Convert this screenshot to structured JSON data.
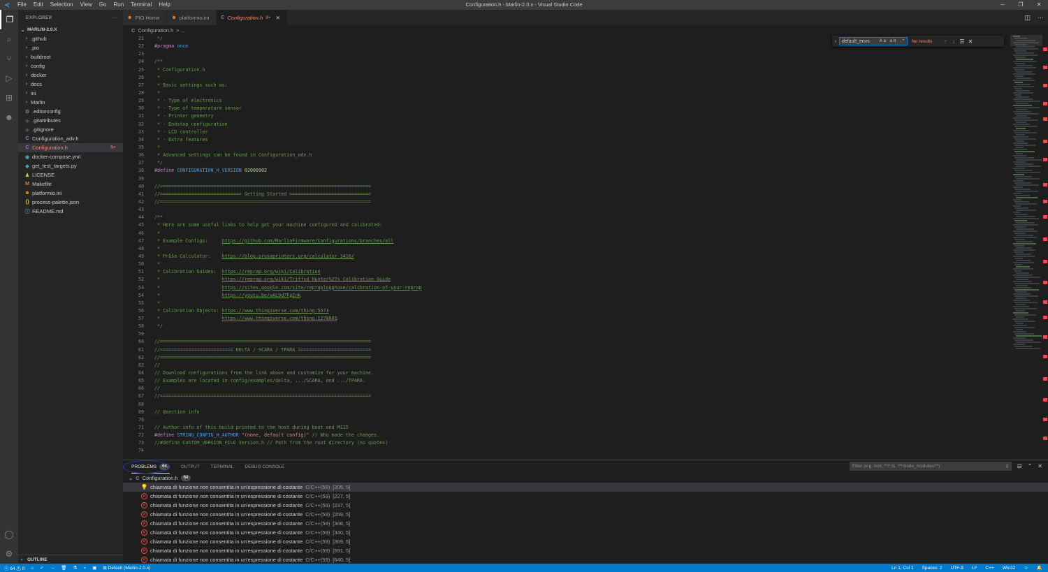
{
  "window": {
    "title": "Configuration.h - Marlin-2.0.x - Visual Studio Code",
    "menu": [
      "File",
      "Edit",
      "Selection",
      "View",
      "Go",
      "Run",
      "Terminal",
      "Help"
    ]
  },
  "sidebar": {
    "header": "EXPLORER",
    "more": "···",
    "root": "MARLIN-2.0.X",
    "items": [
      {
        "label": ".github",
        "type": "folder"
      },
      {
        "label": ".pio",
        "type": "folder"
      },
      {
        "label": "buildroot",
        "type": "folder"
      },
      {
        "label": "config",
        "type": "folder"
      },
      {
        "label": "docker",
        "type": "folder"
      },
      {
        "label": "docs",
        "type": "folder"
      },
      {
        "label": "ini",
        "type": "folder"
      },
      {
        "label": "Marlin",
        "type": "folder"
      },
      {
        "label": ".editorconfig",
        "type": "gear",
        "icon": "⚙",
        "color": "#6d8086"
      },
      {
        "label": ".gitattributes",
        "type": "git",
        "icon": "◆",
        "color": "#41535b"
      },
      {
        "label": ".gitignore",
        "type": "git",
        "icon": "◆",
        "color": "#41535b"
      },
      {
        "label": "Configuration_adv.h",
        "type": "c",
        "icon": "C",
        "color": "#a074c4"
      },
      {
        "label": "Configuration.h",
        "type": "c",
        "icon": "C",
        "color": "#a074c4",
        "selected": true,
        "error": true,
        "badge": "9+"
      },
      {
        "label": "docker-compose.yml",
        "type": "docker",
        "icon": "◉",
        "color": "#519aba"
      },
      {
        "label": "get_test_targets.py",
        "type": "python",
        "icon": "◆",
        "color": "#519aba"
      },
      {
        "label": "LICENSE",
        "type": "license",
        "icon": "♟",
        "color": "#cbcb41"
      },
      {
        "label": "Makefile",
        "type": "make",
        "icon": "M",
        "color": "#e37933"
      },
      {
        "label": "platformio.ini",
        "type": "pio",
        "icon": "☻",
        "color": "#f5871f"
      },
      {
        "label": "process-palette.json",
        "type": "json",
        "icon": "{}",
        "color": "#cbcb41"
      },
      {
        "label": "README.md",
        "type": "md",
        "icon": "ⓘ",
        "color": "#519aba"
      }
    ],
    "outline": "OUTLINE"
  },
  "tabs": [
    {
      "label": "PIO Home",
      "icon": "☻",
      "color": "#f5871f",
      "active": false
    },
    {
      "label": "platformio.ini",
      "icon": "☻",
      "color": "#f5871f",
      "active": false
    },
    {
      "label": "Configuration.h",
      "icon": "C",
      "color": "#a074c4",
      "active": true,
      "badge": "9+"
    }
  ],
  "breadcrumb": {
    "file": "Configuration.h",
    "rest": "> ..."
  },
  "find": {
    "value": "default_envs",
    "options": "Aa ab .*",
    "result": "No results"
  },
  "editor": {
    "lines": [
      {
        "n": "21",
        "t": [
          [
            "comment",
            " */"
          ]
        ]
      },
      {
        "n": "22",
        "t": [
          [
            "pre",
            "#pragma"
          ],
          [
            "plain",
            " "
          ],
          [
            "macro",
            "once"
          ]
        ]
      },
      {
        "n": "23",
        "t": []
      },
      {
        "n": "24",
        "t": [
          [
            "comment",
            "/**"
          ]
        ]
      },
      {
        "n": "25",
        "t": [
          [
            "comment",
            " * Configuration.h"
          ]
        ]
      },
      {
        "n": "26",
        "t": [
          [
            "comment",
            " *"
          ]
        ]
      },
      {
        "n": "27",
        "t": [
          [
            "comment",
            " * Basic settings such as:"
          ]
        ]
      },
      {
        "n": "28",
        "t": [
          [
            "comment",
            " *"
          ]
        ]
      },
      {
        "n": "29",
        "t": [
          [
            "comment",
            " * - Type of electronics"
          ]
        ]
      },
      {
        "n": "30",
        "t": [
          [
            "comment",
            " * - Type of temperature sensor"
          ]
        ]
      },
      {
        "n": "31",
        "t": [
          [
            "comment",
            " * - Printer geometry"
          ]
        ]
      },
      {
        "n": "32",
        "t": [
          [
            "comment",
            " * - Endstop configuration"
          ]
        ]
      },
      {
        "n": "33",
        "t": [
          [
            "comment",
            " * - LCD controller"
          ]
        ]
      },
      {
        "n": "34",
        "t": [
          [
            "comment",
            " * - Extra features"
          ]
        ]
      },
      {
        "n": "35",
        "t": [
          [
            "comment",
            " *"
          ]
        ]
      },
      {
        "n": "36",
        "t": [
          [
            "comment",
            " * Advanced settings can be found in Configuration_adv.h"
          ]
        ]
      },
      {
        "n": "37",
        "t": [
          [
            "comment",
            " */"
          ]
        ]
      },
      {
        "n": "38",
        "t": [
          [
            "pre",
            "#define"
          ],
          [
            "plain",
            " "
          ],
          [
            "macro",
            "CONFIGURATION_H_VERSION"
          ],
          [
            "plain",
            " "
          ],
          [
            "num",
            "02000902"
          ]
        ]
      },
      {
        "n": "39",
        "t": []
      },
      {
        "n": "40",
        "t": [
          [
            "comment",
            "//==========================================================================="
          ]
        ]
      },
      {
        "n": "41",
        "t": [
          [
            "comment",
            "//============================= Getting Started ============================="
          ]
        ]
      },
      {
        "n": "42",
        "t": [
          [
            "comment",
            "//==========================================================================="
          ]
        ]
      },
      {
        "n": "43",
        "t": []
      },
      {
        "n": "44",
        "t": [
          [
            "comment",
            "/**"
          ]
        ]
      },
      {
        "n": "45",
        "t": [
          [
            "comment",
            " * Here are some useful links to help get your machine configured and calibrated:"
          ]
        ]
      },
      {
        "n": "46",
        "t": [
          [
            "comment",
            " *"
          ]
        ]
      },
      {
        "n": "47",
        "t": [
          [
            "comment",
            " * Example Configs:     "
          ],
          [
            "link",
            "https://github.com/MarlinFirmware/Configurations/branches/all"
          ]
        ]
      },
      {
        "n": "48",
        "t": [
          [
            "comment",
            " *"
          ]
        ]
      },
      {
        "n": "49",
        "t": [
          [
            "comment",
            " * Průša Calculator:    "
          ],
          [
            "link",
            "https://blog.prusaprinters.org/calculator_3416/"
          ]
        ]
      },
      {
        "n": "50",
        "t": [
          [
            "comment",
            " *"
          ]
        ]
      },
      {
        "n": "51",
        "t": [
          [
            "comment",
            " * Calibration Guides:  "
          ],
          [
            "link",
            "https://reprap.org/wiki/Calibration"
          ]
        ]
      },
      {
        "n": "52",
        "t": [
          [
            "comment",
            " *                      "
          ],
          [
            "link",
            "https://reprap.org/wiki/Triffid_Hunter%27s_Calibration_Guide"
          ]
        ]
      },
      {
        "n": "53",
        "t": [
          [
            "comment",
            " *                      "
          ],
          [
            "link",
            "https://sites.google.com/site/repraplogphase/calibration-of-your-reprap"
          ]
        ]
      },
      {
        "n": "54",
        "t": [
          [
            "comment",
            " *                      "
          ],
          [
            "link",
            "https://youtu.be/wAL9d7FgInk"
          ]
        ]
      },
      {
        "n": "55",
        "t": [
          [
            "comment",
            " *"
          ]
        ]
      },
      {
        "n": "56",
        "t": [
          [
            "comment",
            " * Calibration Objects: "
          ],
          [
            "link",
            "https://www.thingiverse.com/thing:5573"
          ]
        ]
      },
      {
        "n": "57",
        "t": [
          [
            "comment",
            " *                      "
          ],
          [
            "link",
            "https://www.thingiverse.com/thing:1278865"
          ]
        ]
      },
      {
        "n": "58",
        "t": [
          [
            "comment",
            " */"
          ]
        ]
      },
      {
        "n": "59",
        "t": []
      },
      {
        "n": "60",
        "t": [
          [
            "comment",
            "//==========================================================================="
          ]
        ]
      },
      {
        "n": "61",
        "t": [
          [
            "comment",
            "//========================== DELTA / SCARA / TPARA =========================="
          ]
        ]
      },
      {
        "n": "62",
        "t": [
          [
            "comment",
            "//==========================================================================="
          ]
        ]
      },
      {
        "n": "63",
        "t": [
          [
            "comment",
            "//"
          ]
        ]
      },
      {
        "n": "64",
        "t": [
          [
            "comment",
            "// Download configurations from the link above and customize for your machine."
          ]
        ]
      },
      {
        "n": "65",
        "t": [
          [
            "comment",
            "// Examples are located in config/examples/delta, .../SCARA, and .../TPARA."
          ]
        ]
      },
      {
        "n": "66",
        "t": [
          [
            "comment",
            "//"
          ]
        ]
      },
      {
        "n": "67",
        "t": [
          [
            "comment",
            "//==========================================================================="
          ]
        ]
      },
      {
        "n": "68",
        "t": []
      },
      {
        "n": "69",
        "t": [
          [
            "comment",
            "// @section info"
          ]
        ]
      },
      {
        "n": "70",
        "t": []
      },
      {
        "n": "71",
        "t": [
          [
            "comment",
            "// Author info of this build printed to the host during boot and M115"
          ]
        ]
      },
      {
        "n": "72",
        "t": [
          [
            "pre",
            "#define"
          ],
          [
            "plain",
            " "
          ],
          [
            "macro",
            "STRING_CONFIG_H_AUTHOR"
          ],
          [
            "plain",
            " "
          ],
          [
            "str",
            "\"(none, default config)\""
          ],
          [
            "plain",
            " "
          ],
          [
            "comment",
            "// Who made the changes."
          ]
        ]
      },
      {
        "n": "73",
        "t": [
          [
            "comment",
            "//#define CUSTOM_VERSION_FILE Version.h // Path from the root directory (no quotes)"
          ]
        ]
      },
      {
        "n": "74",
        "t": []
      }
    ]
  },
  "panel": {
    "tabs": [
      {
        "label": "PROBLEMS",
        "count": "64",
        "active": true
      },
      {
        "label": "OUTPUT"
      },
      {
        "label": "TERMINAL"
      },
      {
        "label": "DEBUG CONSOLE"
      }
    ],
    "filter_placeholder": "Filter (e.g. text, **/*.ts, !**/node_modules/**)",
    "file": {
      "name": "Configuration.h",
      "count": "64"
    },
    "problems": [
      {
        "severity": "warning",
        "msg": "chiamata di funzione non consentita in un'espressione di costante",
        "src": "C/C++(59)",
        "loc": "[205, 5]",
        "selected": true
      },
      {
        "severity": "error",
        "msg": "chiamata di funzione non consentita in un'espressione di costante",
        "src": "C/C++(59)",
        "loc": "[227, 5]"
      },
      {
        "severity": "error",
        "msg": "chiamata di funzione non consentita in un'espressione di costante",
        "src": "C/C++(59)",
        "loc": "[237, 5]"
      },
      {
        "severity": "error",
        "msg": "chiamata di funzione non consentita in un'espressione di costante",
        "src": "C/C++(59)",
        "loc": "[259, 5]"
      },
      {
        "severity": "error",
        "msg": "chiamata di funzione non consentita in un'espressione di costante",
        "src": "C/C++(59)",
        "loc": "[308, 5]"
      },
      {
        "severity": "error",
        "msg": "chiamata di funzione non consentita in un'espressione di costante",
        "src": "C/C++(59)",
        "loc": "[340, 5]"
      },
      {
        "severity": "error",
        "msg": "chiamata di funzione non consentita in un'espressione di costante",
        "src": "C/C++(59)",
        "loc": "[369, 5]"
      },
      {
        "severity": "error",
        "msg": "chiamata di funzione non consentita in un'espressione di costante",
        "src": "C/C++(59)",
        "loc": "[591, 5]"
      },
      {
        "severity": "error",
        "msg": "chiamata di funzione non consentita in un'espressione di costante",
        "src": "C/C++(59)",
        "loc": "[640, 5]"
      }
    ]
  },
  "statusbar": {
    "errors": "64",
    "warnings": "0",
    "env": "Default (Marlin-2.0.x)",
    "position": "Ln 1, Col 1",
    "spaces": "Spaces: 2",
    "encoding": "UTF-8",
    "eol": "LF",
    "language": "C++",
    "platform": "Win32"
  },
  "colors": {
    "accent": "#007acc",
    "error": "#f48771",
    "warning": "#cca700",
    "highlight_ring": "#1e36c8"
  }
}
